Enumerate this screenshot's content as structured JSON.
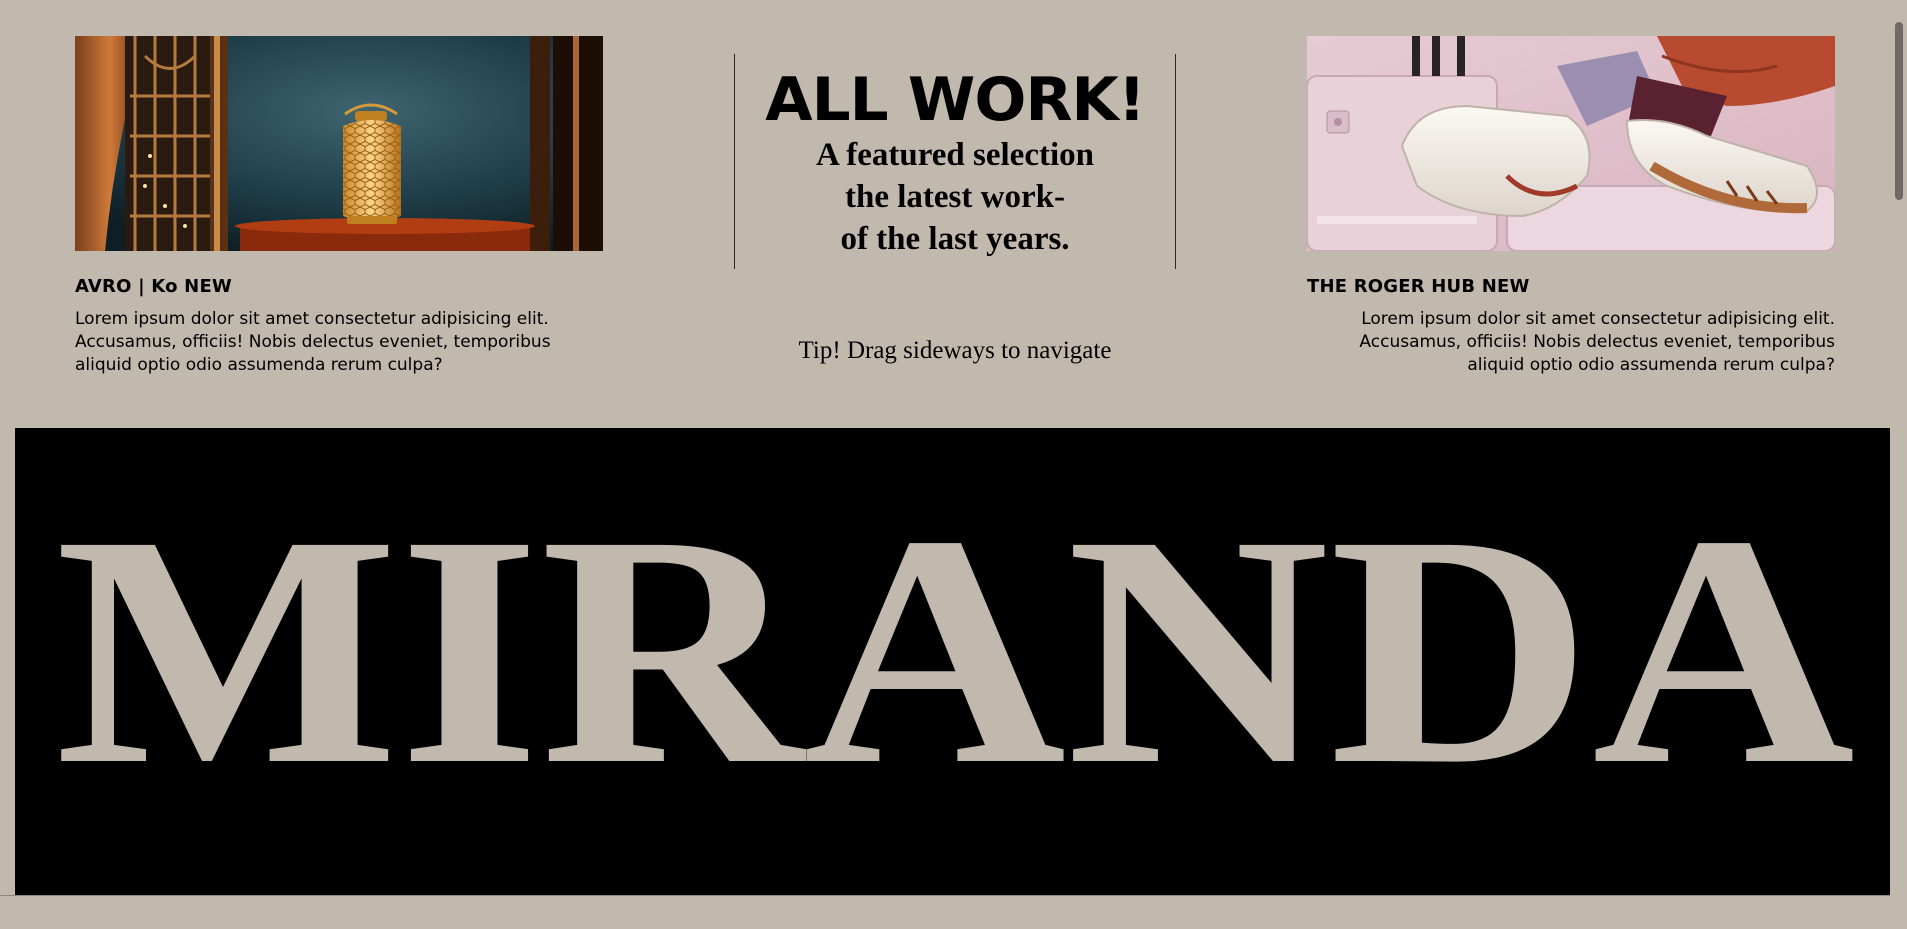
{
  "projects": [
    {
      "title": "AVRO | Ko NEW",
      "description": "Lorem ipsum dolor sit amet consectetur adipisicing elit. Accusamus, officiis! Nobis delectus eveniet, temporibus aliquid optio odio assumenda rerum culpa?",
      "image_icon": "lantern-image"
    },
    {
      "title": "THE ROGER HUB NEW",
      "description": "Lorem ipsum dolor sit amet consectetur adipisicing elit. Accusamus, officiis! Nobis delectus eveniet, temporibus aliquid optio odio assumenda rerum culpa?",
      "image_icon": "sneakers-image"
    }
  ],
  "center": {
    "headline": "ALL WORK!",
    "subhead_lines": [
      "A featured selection",
      "the latest work-",
      "of the last years."
    ],
    "tip": "Tip! Drag sideways to navigate"
  },
  "banner": {
    "text": "MIRANDA"
  },
  "colors": {
    "background": "#c1b8ae",
    "banner_bg": "#000000",
    "banner_text": "#c1b8ae",
    "text": "#000000"
  }
}
